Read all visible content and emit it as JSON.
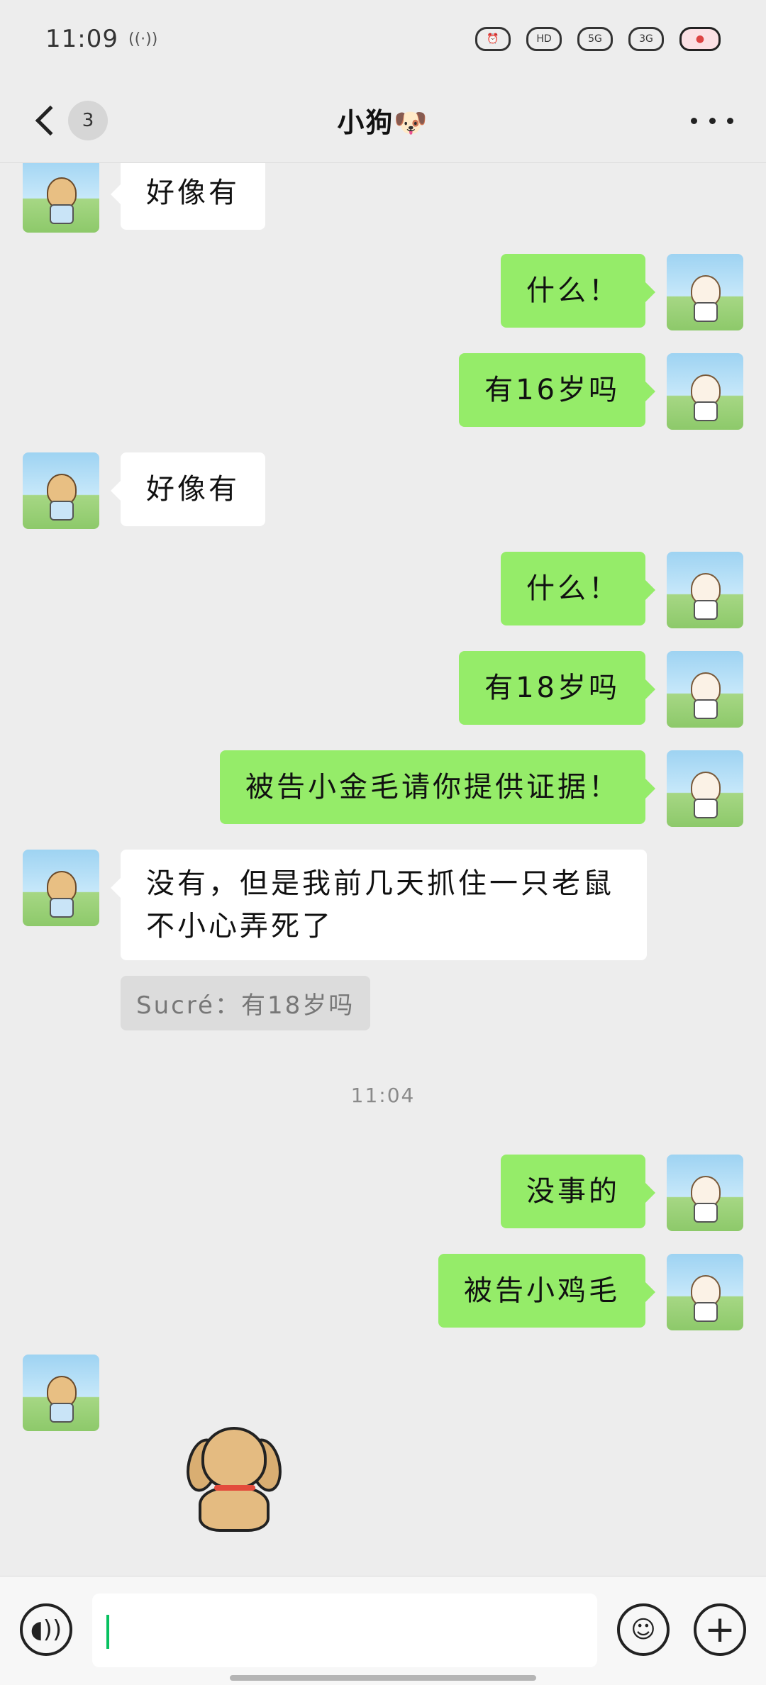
{
  "status_bar": {
    "time": "11:09",
    "signal_label": "((·))",
    "icons": [
      "alarm-icon",
      "hd-icon",
      "5g-icon",
      "signal-icon",
      "battery-icon"
    ],
    "hd_label": "HD",
    "fiveg_label": "5G",
    "signal_label2": "3G"
  },
  "header": {
    "title": "小狗🐶",
    "unread_count": "3"
  },
  "messages": [
    {
      "side": "in",
      "text": "好像有"
    },
    {
      "side": "out",
      "text": "什么！"
    },
    {
      "side": "out",
      "text": "有16岁吗"
    },
    {
      "side": "in",
      "text": "好像有"
    },
    {
      "side": "out",
      "text": "什么！"
    },
    {
      "side": "out",
      "text": "有18岁吗"
    },
    {
      "side": "out",
      "text": "被告小金毛请你提供证据！"
    },
    {
      "side": "in",
      "text": "没有，但是我前几天抓住一只老鼠不小心弄死了",
      "quote": "Sucré：有18岁吗"
    },
    {
      "side": "out",
      "text": "没事的"
    },
    {
      "side": "out",
      "text": "被告小鸡毛"
    },
    {
      "side": "in",
      "sticker": "dog-sticker"
    }
  ],
  "timestamp": "11:04",
  "input": {
    "placeholder": "",
    "voice_icon": "voice-icon",
    "emoji_icon": "emoji-icon",
    "plus_icon": "plus-icon"
  },
  "colors": {
    "background": "#ededed",
    "outgoing_bubble": "#95ec69",
    "incoming_bubble": "#ffffff",
    "caret": "#07c160"
  }
}
